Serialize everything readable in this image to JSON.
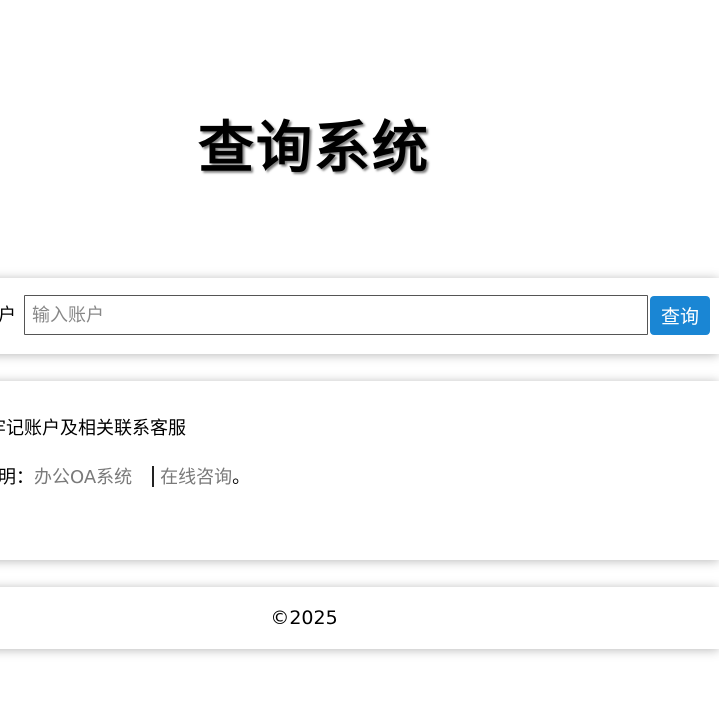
{
  "page": {
    "title": "查询系统"
  },
  "search": {
    "label": "账户",
    "placeholder": "输入账户",
    "button_label": "查询"
  },
  "notice": {
    "line1": "请牢记账户及相关联系客服",
    "line2_label": "说明：",
    "link_oa": "办公OA系统",
    "link_consult": "在线咨询",
    "line2_end": "。"
  },
  "footer": {
    "copyright": "©2025"
  },
  "colors": {
    "primary_button": "#1a86d4",
    "muted_link": "#7a7a7a",
    "background": "#ffffff"
  }
}
